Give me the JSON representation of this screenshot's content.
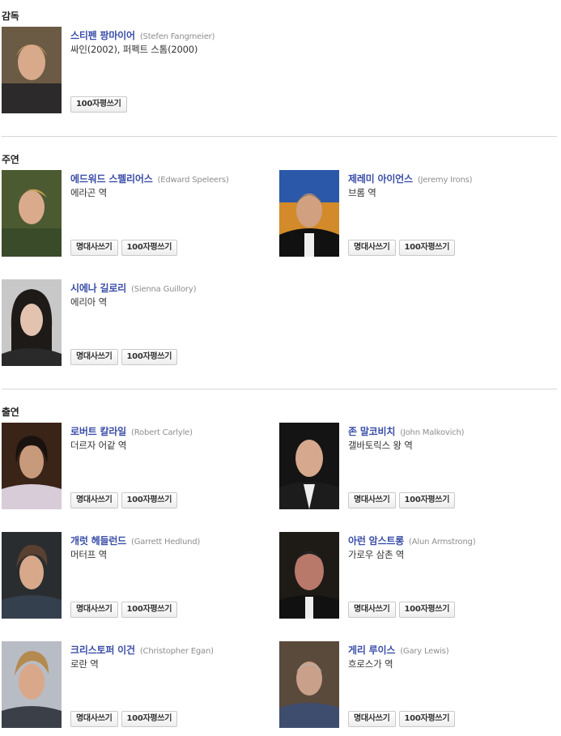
{
  "sections": {
    "director": "감독",
    "lead": "주연",
    "support": "출연"
  },
  "buttons": {
    "quote": "명대사쓰기",
    "review": "100자평쓰기"
  },
  "director": {
    "name": "스티펜 팡마이어",
    "eng": "(Stefen Fangmeier)",
    "works": "싸인(2002), 퍼펙트 스톰(2000)"
  },
  "lead": [
    {
      "name": "에드워드 스펠리어스",
      "eng": "(Edward Speleers)",
      "role": "에라곤 역"
    },
    {
      "name": "제레미 아이언스",
      "eng": "(Jeremy Irons)",
      "role": "브롬 역"
    },
    {
      "name": "시에나 길로리",
      "eng": "(Sienna Guillory)",
      "role": "에리아 역"
    }
  ],
  "support": [
    {
      "name": "로버트 칼라일",
      "eng": "(Robert Carlyle)",
      "role": "더르자 어같 역"
    },
    {
      "name": "존 말코비치",
      "eng": "(John Malkovich)",
      "role": "갤바토릭스 왕 역"
    },
    {
      "name": "개럿 헤들런드",
      "eng": "(Garrett Hedlund)",
      "role": "머터프 역"
    },
    {
      "name": "아런 암스트롱",
      "eng": "(Alun Armstrong)",
      "role": "가로우 삼촌 역"
    },
    {
      "name": "크리스토퍼 이건",
      "eng": "(Christopher Egan)",
      "role": "로란 역"
    },
    {
      "name": "게리 루이스",
      "eng": "(Gary Lewis)",
      "role": "흐로스가 역"
    }
  ]
}
